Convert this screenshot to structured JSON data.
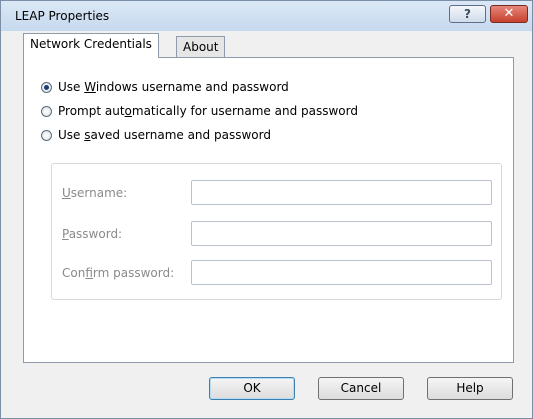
{
  "window": {
    "title": "LEAP Properties",
    "help_glyph": "?",
    "close_glyph": "✕"
  },
  "tabs": [
    {
      "label": "Network Credentials",
      "selected": true
    },
    {
      "label": "About",
      "selected": false
    }
  ],
  "options": [
    {
      "pre": "Use ",
      "mnemonic": "W",
      "post": "indows username and password",
      "checked": true
    },
    {
      "pre": "Prompt aut",
      "mnemonic": "o",
      "post": "matically for username and password",
      "checked": false
    },
    {
      "pre": "Use ",
      "mnemonic": "s",
      "post": "aved username and password",
      "checked": false
    }
  ],
  "fields": [
    {
      "pre": "",
      "mnemonic": "U",
      "post": "sername:",
      "value": ""
    },
    {
      "pre": "",
      "mnemonic": "P",
      "post": "assword:",
      "value": ""
    },
    {
      "pre": "Con",
      "mnemonic": "f",
      "post": "irm password:",
      "value": ""
    }
  ],
  "buttons": {
    "ok": "OK",
    "cancel": "Cancel",
    "help": "Help"
  },
  "colors": {
    "selected_radio": "#1f3d73",
    "close_button": "#c7402e",
    "disabled_text": "#8a8a8a"
  }
}
